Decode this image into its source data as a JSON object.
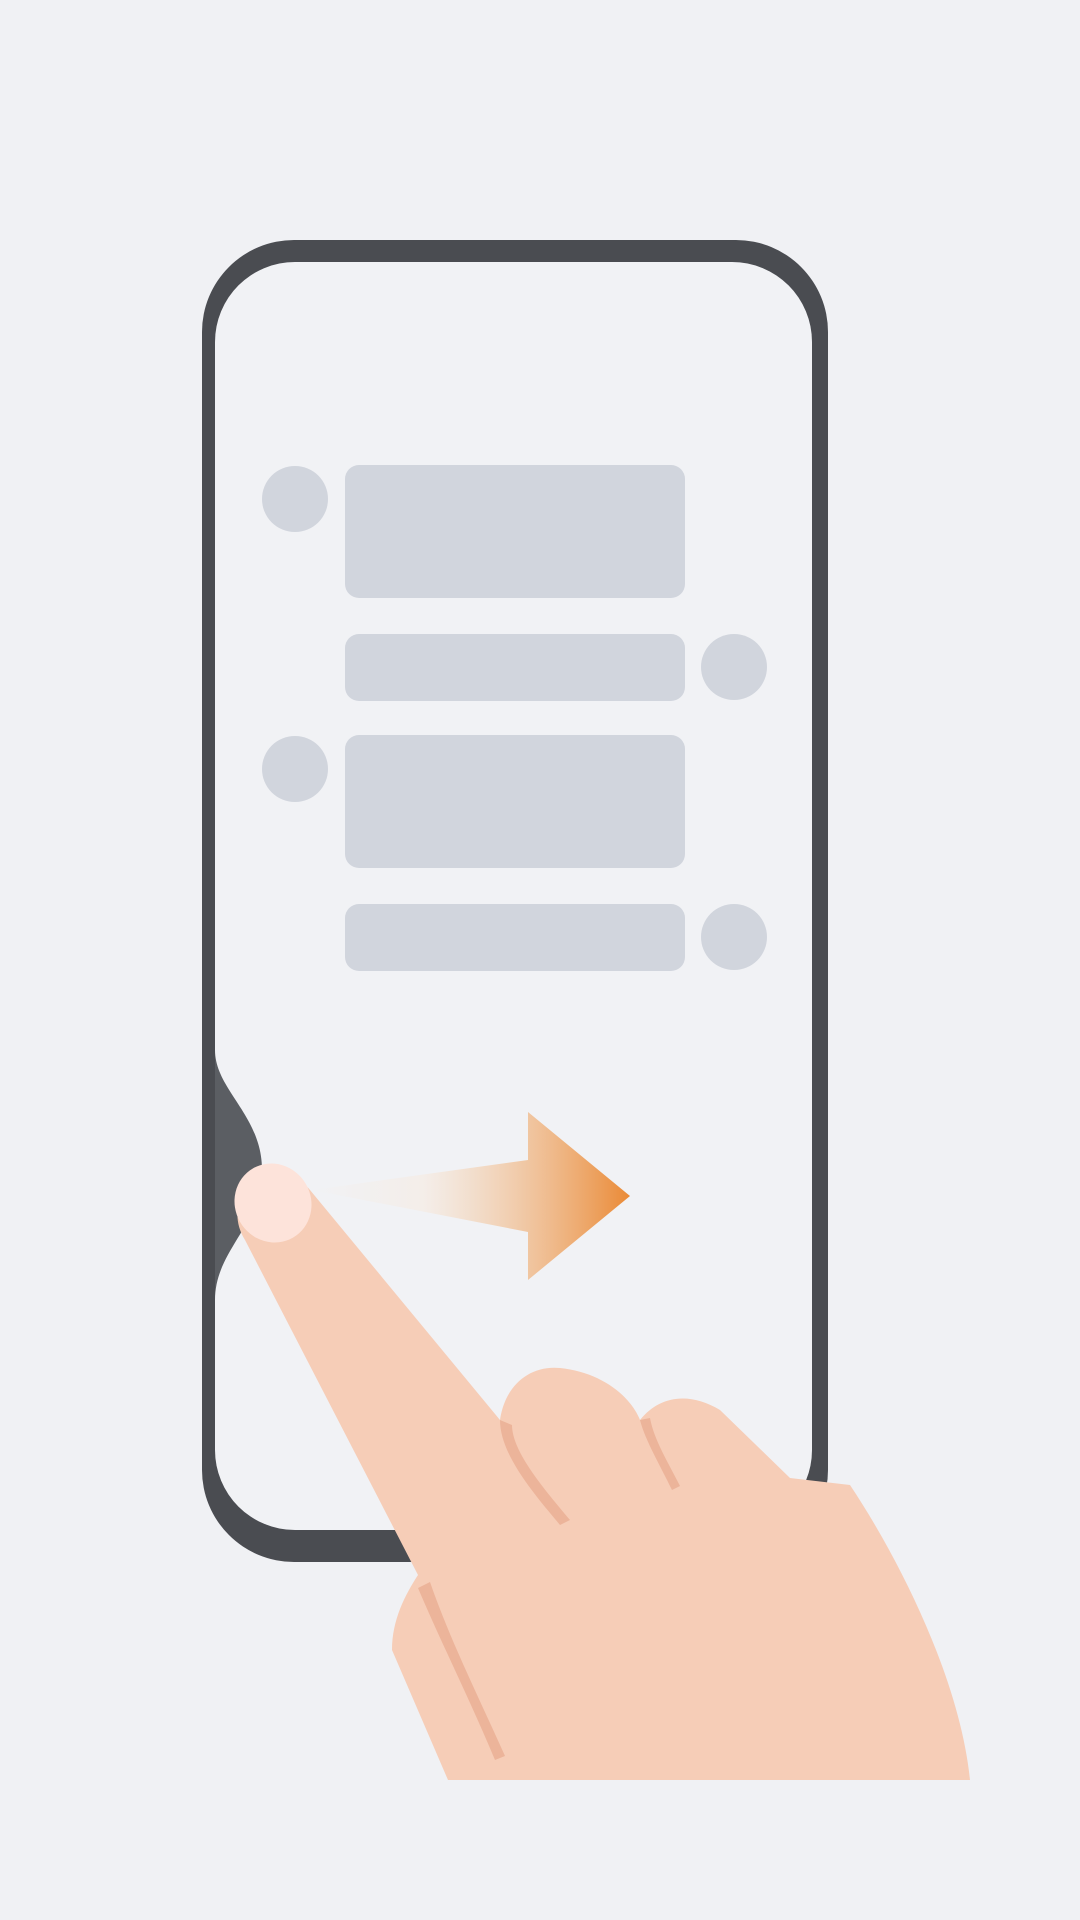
{
  "illustration": {
    "icon": "swipe-back-gesture-illustration",
    "description_icons": [
      "phone-frame-icon",
      "chat-list-placeholder-icon",
      "swipe-right-arrow-icon",
      "pointing-hand-icon"
    ]
  },
  "colors": {
    "background": "#f0f1f4",
    "phone_frame": "#4a4c51",
    "phone_screen": "#f1f2f5",
    "placeholder": "#d1d5dd",
    "back_gesture_bulge": "#5b5e63",
    "arrow_start": "#f6eadf",
    "arrow_end": "#ea8a36",
    "hand_skin": "#f6cdb7",
    "hand_shadow": "#ecb49a",
    "fingernail": "#fde3da"
  },
  "chat_list": {
    "rows": [
      {
        "side": "left",
        "size": "large"
      },
      {
        "side": "right",
        "size": "small"
      },
      {
        "side": "left",
        "size": "large"
      },
      {
        "side": "right",
        "size": "small"
      }
    ]
  },
  "gesture": {
    "direction": "right",
    "edge": "left"
  }
}
